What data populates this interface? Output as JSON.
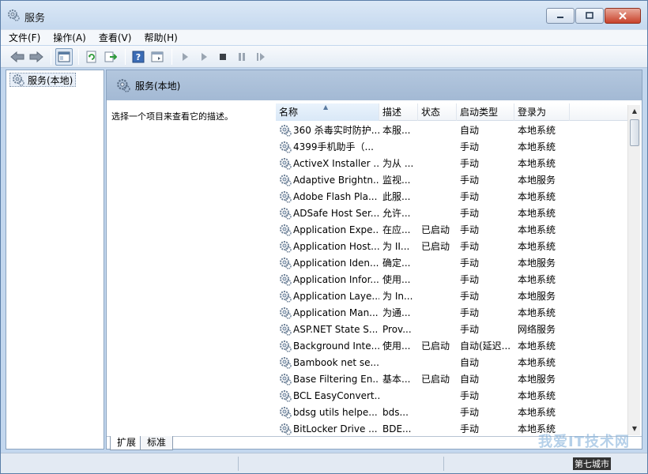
{
  "window": {
    "title": "服务",
    "buttons": [
      "minimize",
      "maximize",
      "close"
    ]
  },
  "menu": [
    "文件(F)",
    "操作(A)",
    "查看(V)",
    "帮助(H)"
  ],
  "toolbar": {
    "icons": [
      "back-arrow-icon",
      "forward-arrow-icon",
      "console-tree-icon",
      "refresh-icon",
      "export-list-icon",
      "help-icon",
      "properties-icon",
      "start-service-icon",
      "start-service-alt-icon",
      "stop-service-icon",
      "pause-service-icon",
      "restart-service-icon"
    ]
  },
  "tree": {
    "item": "服务(本地)"
  },
  "pane": {
    "header": "服务(本地)",
    "description": "选择一个项目来查看它的描述。"
  },
  "columns": [
    "名称",
    "描述",
    "状态",
    "启动类型",
    "登录为"
  ],
  "rows": [
    {
      "name": "360 杀毒实时防护...",
      "desc": "本服...",
      "status": "",
      "startup": "自动",
      "logon": "本地系统"
    },
    {
      "name": "4399手机助手（...",
      "desc": "",
      "status": "",
      "startup": "手动",
      "logon": "本地系统"
    },
    {
      "name": "ActiveX Installer ...",
      "desc": "为从 ...",
      "status": "",
      "startup": "手动",
      "logon": "本地系统"
    },
    {
      "name": "Adaptive Brightn...",
      "desc": "监视...",
      "status": "",
      "startup": "手动",
      "logon": "本地服务"
    },
    {
      "name": "Adobe Flash Pla...",
      "desc": "此服...",
      "status": "",
      "startup": "手动",
      "logon": "本地系统"
    },
    {
      "name": "ADSafe Host Ser...",
      "desc": "允许...",
      "status": "",
      "startup": "手动",
      "logon": "本地系统"
    },
    {
      "name": "Application Expe...",
      "desc": "在应...",
      "status": "已启动",
      "startup": "手动",
      "logon": "本地系统"
    },
    {
      "name": "Application Host...",
      "desc": "为 II...",
      "status": "已启动",
      "startup": "手动",
      "logon": "本地系统"
    },
    {
      "name": "Application Iden...",
      "desc": "确定...",
      "status": "",
      "startup": "手动",
      "logon": "本地服务"
    },
    {
      "name": "Application Infor...",
      "desc": "使用...",
      "status": "",
      "startup": "手动",
      "logon": "本地系统"
    },
    {
      "name": "Application Laye...",
      "desc": "为 In...",
      "status": "",
      "startup": "手动",
      "logon": "本地服务"
    },
    {
      "name": "Application Man...",
      "desc": "为通...",
      "status": "",
      "startup": "手动",
      "logon": "本地系统"
    },
    {
      "name": "ASP.NET State S...",
      "desc": "Prov...",
      "status": "",
      "startup": "手动",
      "logon": "网络服务"
    },
    {
      "name": "Background Inte...",
      "desc": "使用...",
      "status": "已启动",
      "startup": "自动(延迟...",
      "logon": "本地系统"
    },
    {
      "name": "Bambook net se...",
      "desc": "",
      "status": "",
      "startup": "自动",
      "logon": "本地系统"
    },
    {
      "name": "Base Filtering En...",
      "desc": "基本...",
      "status": "已启动",
      "startup": "自动",
      "logon": "本地服务"
    },
    {
      "name": "BCL EasyConvert...",
      "desc": "",
      "status": "",
      "startup": "手动",
      "logon": "本地系统"
    },
    {
      "name": "bdsg utils helpe...",
      "desc": "bds...",
      "status": "",
      "startup": "手动",
      "logon": "本地系统"
    },
    {
      "name": "BitLocker Drive ...",
      "desc": "BDE...",
      "status": "",
      "startup": "手动",
      "logon": "本地系统"
    }
  ],
  "tabs": [
    "扩展",
    "标准"
  ],
  "watermark": {
    "text": "我爱IT技术网",
    "tag": "第七城市"
  }
}
